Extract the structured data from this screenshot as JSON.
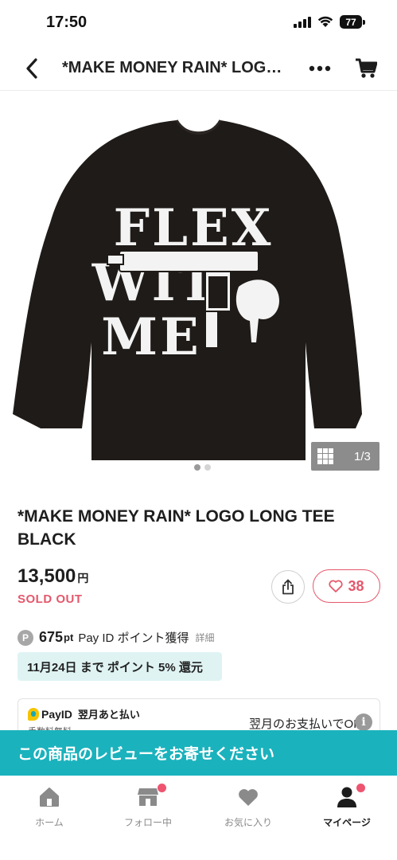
{
  "status_bar": {
    "time": "17:50",
    "battery": "77"
  },
  "header": {
    "title": "*MAKE MONEY RAIN* LOGO LONG TEE BLACK",
    "back_icon": "chevron-left-icon",
    "more_icon": "more-horizontal-icon",
    "cart_icon": "cart-icon"
  },
  "gallery": {
    "counter": "1/3",
    "total_pages": 2,
    "active_page": 0,
    "print_text": [
      "FLEX",
      "WIT",
      "ME"
    ],
    "shirt_color": "#1f1b18"
  },
  "product": {
    "title": "*MAKE MONEY RAIN* LOGO LONG TEE BLACK",
    "price": "13,500",
    "currency": "円",
    "status": "SOLD OUT",
    "like_count": "38"
  },
  "points": {
    "coin": "P",
    "value": "675",
    "unit": "pt",
    "label": "Pay ID ポイント獲得",
    "detail": "詳細",
    "campaign": "11月24日 まで ポイント 5% 還元"
  },
  "payid": {
    "brand": "PayID",
    "label": "翌月あと払い",
    "sub": "手数料無料",
    "ok_text": "翌月のお支払いでOK",
    "info": "i"
  },
  "review_banner": "この商品のレビューをお寄せください",
  "tabs": [
    {
      "label": "ホーム",
      "icon": "home-icon",
      "active": false
    },
    {
      "label": "フォロー中",
      "icon": "shop-icon",
      "active": false
    },
    {
      "label": "お気に入り",
      "icon": "heart-icon",
      "active": false
    },
    {
      "label": "マイページ",
      "icon": "user-icon",
      "active": true
    }
  ],
  "colors": {
    "accent_pink": "#e5576b",
    "teal": "#1ab2bd",
    "campaign_bg": "#dff3f3",
    "tab_active": "#1c1c1c",
    "tab_inactive": "#8a8a8a"
  }
}
